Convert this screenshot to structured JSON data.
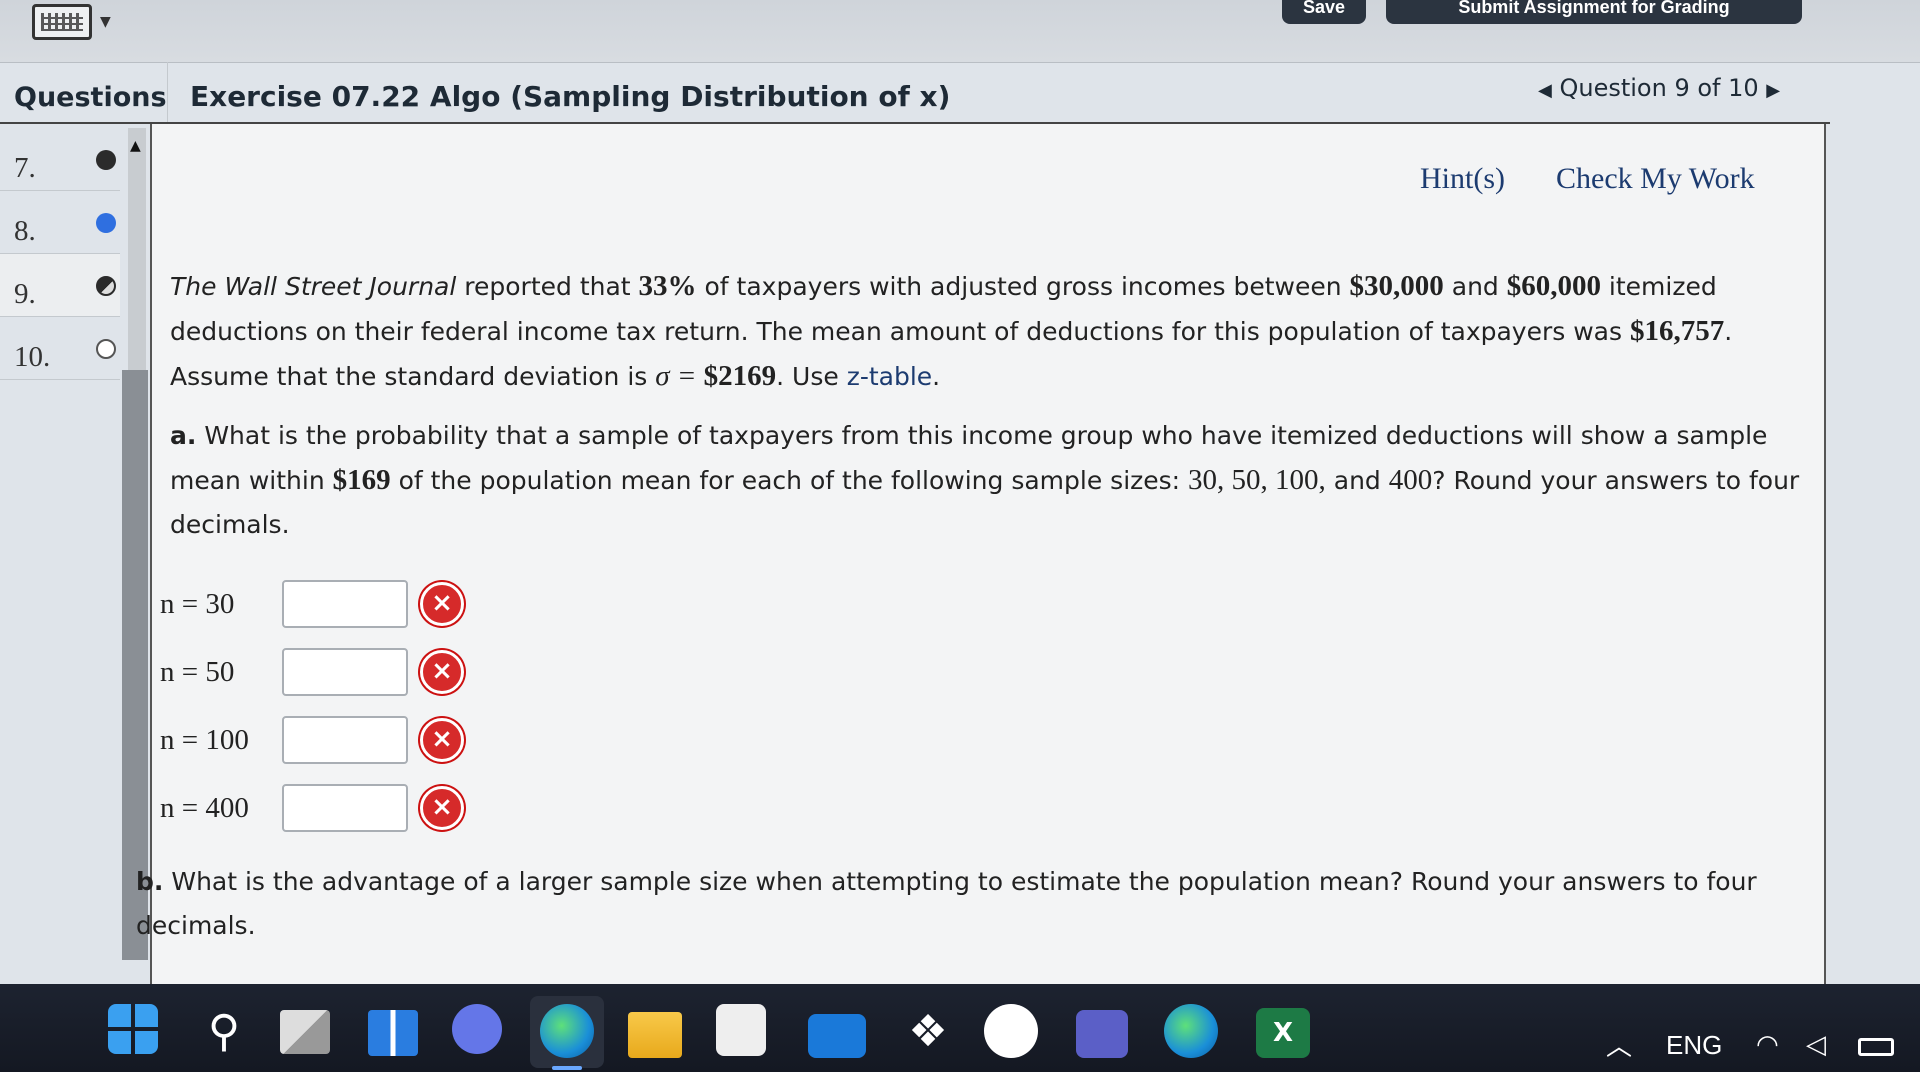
{
  "topbar": {
    "save_label": "Save",
    "submit_label": "Submit Assignment for Grading"
  },
  "sidebar": {
    "title": "Questions",
    "items": [
      {
        "num": "7.",
        "status": "check"
      },
      {
        "num": "8.",
        "status": "dot"
      },
      {
        "num": "9.",
        "status": "half"
      },
      {
        "num": "10.",
        "status": "empty"
      }
    ]
  },
  "header": {
    "title": "Exercise 07.22 Algo (Sampling Distribution of x)",
    "question_nav": "Question 9 of 10"
  },
  "links": {
    "hint": "Hint(s)",
    "check": "Check My Work"
  },
  "problem": {
    "journal": "The Wall Street Journal",
    "t1": " reported that ",
    "pct": "33%",
    "t2": " of taxpayers with adjusted gross incomes between ",
    "inc_low": "$30,000",
    "t3": " and ",
    "inc_high": "$60,000",
    "t4": " itemized deductions on their federal income tax return. The mean amount of deductions for this population of taxpayers was ",
    "mean": "$16,757",
    "t5": ". Assume that the standard deviation is ",
    "sigma_sym": "σ = ",
    "sigma": "$2169",
    "t6": ". Use ",
    "ztable": "z-table",
    "t7": "."
  },
  "part_a": {
    "label": "a.",
    "t1": " What is the probability that a sample of taxpayers from this income group who have itemized deductions will show a sample mean within ",
    "within": "$169",
    "t2": " of the population mean for each of the following sample sizes: ",
    "sizes": "30, 50, 100,",
    "t3": " and ",
    "last": "400",
    "t4": "? Round your answers to four decimals."
  },
  "answers": [
    {
      "label": "n = 30",
      "value": ""
    },
    {
      "label": "n = 50",
      "value": ""
    },
    {
      "label": "n = 100",
      "value": ""
    },
    {
      "label": "n = 400",
      "value": ""
    }
  ],
  "part_b": {
    "label": "b.",
    "text": " What is the advantage of a larger sample size when attempting to estimate the population mean? Round your answers to four decimals."
  },
  "tray": {
    "lang": "ENG"
  },
  "icons": {
    "taskbar": [
      "windows-icon",
      "search-icon",
      "task-view-icon",
      "widgets-icon",
      "chat-icon",
      "edge-icon",
      "file-explorer-icon",
      "store-icon",
      "mail-icon",
      "dropbox-icon",
      "lens-icon",
      "teams-icon",
      "edge-dev-icon",
      "excel-icon"
    ]
  }
}
